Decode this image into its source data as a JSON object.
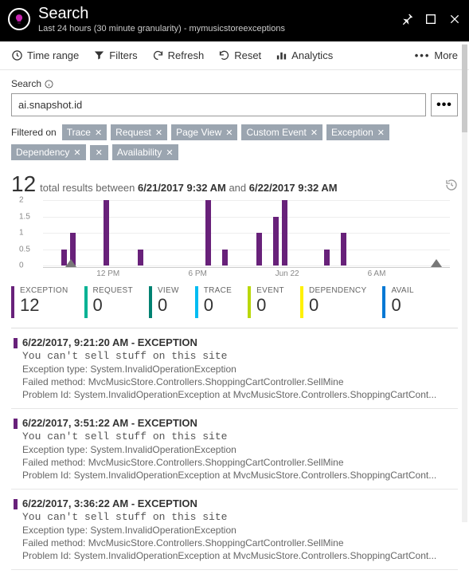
{
  "header": {
    "title": "Search",
    "subtitle": "Last 24 hours (30 minute granularity) - mymusicstoreexceptions"
  },
  "toolbar": {
    "time_range": "Time range",
    "filters": "Filters",
    "refresh": "Refresh",
    "reset": "Reset",
    "analytics": "Analytics",
    "more": "More"
  },
  "search": {
    "label": "Search",
    "value": "ai.snapshot.id",
    "filtered_on": "Filtered on",
    "chips": [
      "Trace",
      "Request",
      "Page View",
      "Custom Event",
      "Exception",
      "Dependency",
      "Availability"
    ]
  },
  "results": {
    "count": "12",
    "prefix": "total results between",
    "from": "6/21/2017 9:32 AM",
    "mid": "and",
    "to": "6/22/2017 9:32 AM"
  },
  "chart_data": {
    "type": "bar",
    "title": "",
    "ylabel": "",
    "xlabel": "",
    "ylim": [
      0,
      2
    ],
    "yticks": [
      0,
      0.5,
      1,
      1.5,
      2
    ],
    "xticks": [
      "12 PM",
      "6 PM",
      "Jun 22",
      "6 AM"
    ],
    "values": [
      0,
      0,
      0.5,
      1,
      0,
      0,
      0,
      2,
      0,
      0,
      0,
      0.5,
      0,
      0,
      0,
      0,
      0,
      0,
      0,
      2,
      0,
      0.5,
      0,
      0,
      0,
      1,
      0,
      1.5,
      2,
      0,
      0,
      0,
      0,
      0.5,
      0,
      1,
      0,
      0,
      0,
      0,
      0,
      0,
      0,
      0,
      0,
      0,
      0,
      0
    ]
  },
  "counters": [
    {
      "label": "EXCEPTION",
      "value": "12",
      "color": "#68217a"
    },
    {
      "label": "REQUEST",
      "value": "0",
      "color": "#00b294"
    },
    {
      "label": "VIEW",
      "value": "0",
      "color": "#008272"
    },
    {
      "label": "TRACE",
      "value": "0",
      "color": "#00bcf2"
    },
    {
      "label": "EVENT",
      "value": "0",
      "color": "#bad80a"
    },
    {
      "label": "DEPENDENCY",
      "value": "0",
      "color": "#fff100"
    },
    {
      "label": "AVAIL",
      "value": "0",
      "color": "#0078d4"
    }
  ],
  "items": [
    {
      "header": "6/22/2017, 9:21:20 AM - EXCEPTION",
      "message": "You can't sell stuff on this site",
      "l1": "Exception type: System.InvalidOperationException",
      "l2": "Failed method: MvcMusicStore.Controllers.ShoppingCartController.SellMine",
      "l3": "Problem Id: System.InvalidOperationException at MvcMusicStore.Controllers.ShoppingCartCont..."
    },
    {
      "header": "6/22/2017, 3:51:22 AM - EXCEPTION",
      "message": "You can't sell stuff on this site",
      "l1": "Exception type: System.InvalidOperationException",
      "l2": "Failed method: MvcMusicStore.Controllers.ShoppingCartController.SellMine",
      "l3": "Problem Id: System.InvalidOperationException at MvcMusicStore.Controllers.ShoppingCartCont..."
    },
    {
      "header": "6/22/2017, 3:36:22 AM - EXCEPTION",
      "message": "You can't sell stuff on this site",
      "l1": "Exception type: System.InvalidOperationException",
      "l2": "Failed method: MvcMusicStore.Controllers.ShoppingCartController.SellMine",
      "l3": "Problem Id: System.InvalidOperationException at MvcMusicStore.Controllers.ShoppingCartCont..."
    }
  ]
}
